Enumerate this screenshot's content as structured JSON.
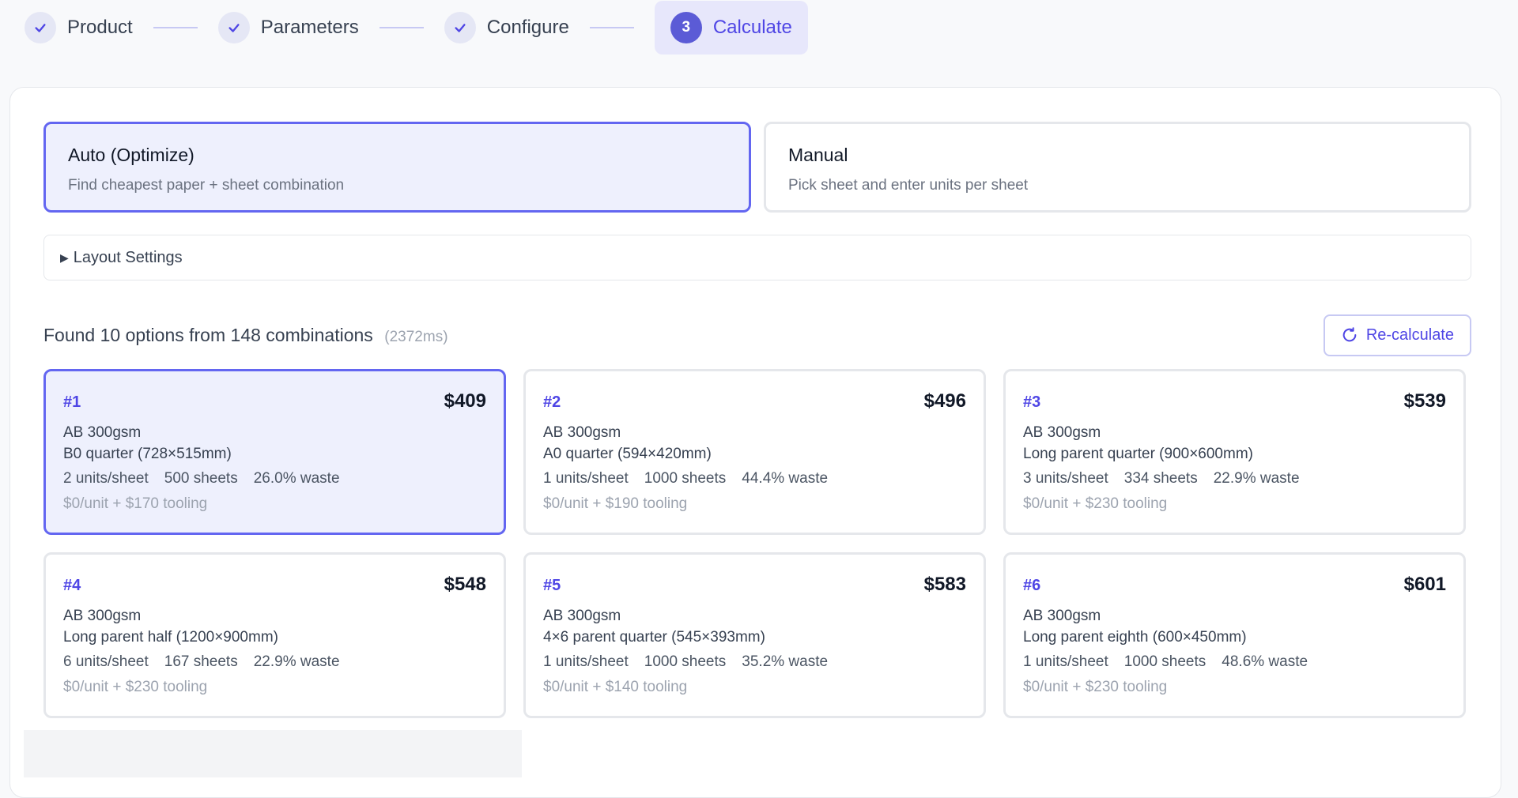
{
  "stepper": {
    "steps": [
      {
        "label": "Product",
        "state": "done"
      },
      {
        "label": "Parameters",
        "state": "done"
      },
      {
        "label": "Configure",
        "state": "done"
      },
      {
        "label": "Calculate",
        "number": "3",
        "state": "active"
      }
    ]
  },
  "modes": {
    "auto": {
      "title": "Auto (Optimize)",
      "desc": "Find cheapest paper + sheet combination",
      "selected": true
    },
    "manual": {
      "title": "Manual",
      "desc": "Pick sheet and enter units per sheet",
      "selected": false
    }
  },
  "layout_settings": {
    "label": "Layout Settings",
    "icon": "triangle-right-icon"
  },
  "results": {
    "summary": "Found 10 options from 148 combinations",
    "time": "(2372ms)",
    "recalc_label": "Re-calculate"
  },
  "options": [
    {
      "rank": "#1",
      "price": "$409",
      "paper": "AB 300gsm",
      "sheet": "B0 quarter (728×515mm)",
      "units": "2 units/sheet",
      "sheets": "500 sheets",
      "waste": "26.0% waste",
      "cost": "$0/unit + $170 tooling"
    },
    {
      "rank": "#2",
      "price": "$496",
      "paper": "AB 300gsm",
      "sheet": "A0 quarter (594×420mm)",
      "units": "1 units/sheet",
      "sheets": "1000 sheets",
      "waste": "44.4% waste",
      "cost": "$0/unit + $190 tooling"
    },
    {
      "rank": "#3",
      "price": "$539",
      "paper": "AB 300gsm",
      "sheet": "Long parent quarter (900×600mm)",
      "units": "3 units/sheet",
      "sheets": "334 sheets",
      "waste": "22.9% waste",
      "cost": "$0/unit + $230 tooling"
    },
    {
      "rank": "#4",
      "price": "$548",
      "paper": "AB 300gsm",
      "sheet": "Long parent half (1200×900mm)",
      "units": "6 units/sheet",
      "sheets": "167 sheets",
      "waste": "22.9% waste",
      "cost": "$0/unit + $230 tooling"
    },
    {
      "rank": "#5",
      "price": "$583",
      "paper": "AB 300gsm",
      "sheet": "4×6 parent quarter (545×393mm)",
      "units": "1 units/sheet",
      "sheets": "1000 sheets",
      "waste": "35.2% waste",
      "cost": "$0/unit + $140 tooling"
    },
    {
      "rank": "#6",
      "price": "$601",
      "paper": "AB 300gsm",
      "sheet": "Long parent eighth (600×450mm)",
      "units": "1 units/sheet",
      "sheets": "1000 sheets",
      "waste": "48.6% waste",
      "cost": "$0/unit + $230 tooling"
    }
  ],
  "colors": {
    "accent": "#4f46e5",
    "accent_bg": "#eef0fd",
    "border": "#e5e7eb"
  }
}
